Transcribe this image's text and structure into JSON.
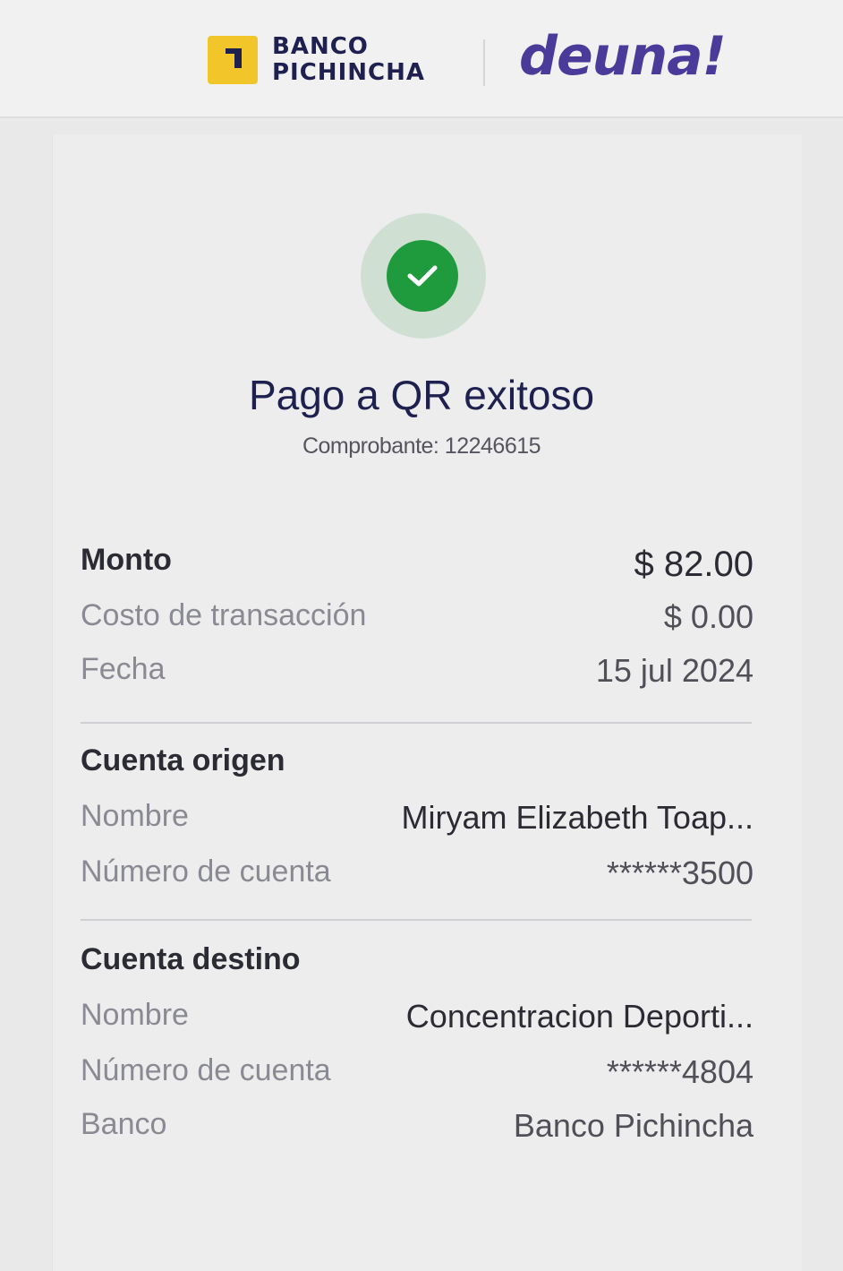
{
  "header": {
    "bank_line1": "BANCO",
    "bank_line2": "PICHINCHA",
    "app_logo": "deuna!"
  },
  "status": {
    "icon": "check-icon",
    "title": "Pago a QR exitoso",
    "receipt": "Comprobante: 12246615"
  },
  "summary": {
    "amount_label": "Monto",
    "amount_value": "$ 82.00",
    "fee_label": "Costo de transacción",
    "fee_value": "$ 0.00",
    "date_label": "Fecha",
    "date_value": "15 jul 2024"
  },
  "origin": {
    "title": "Cuenta origen",
    "name_label": "Nombre",
    "name_value": "Miryam Elizabeth Toap...",
    "account_label": "Número de cuenta",
    "account_value": "******3500"
  },
  "destination": {
    "title": "Cuenta destino",
    "name_label": "Nombre",
    "name_value": "Concentracion Deporti...",
    "account_label": "Número de cuenta",
    "account_value": "******4804",
    "bank_label": "Banco",
    "bank_value": "Banco Pichincha"
  },
  "colors": {
    "brand_yellow": "#f2c62a",
    "deuna_purple": "#4a3a9a",
    "success_green": "#1f9a3c"
  }
}
